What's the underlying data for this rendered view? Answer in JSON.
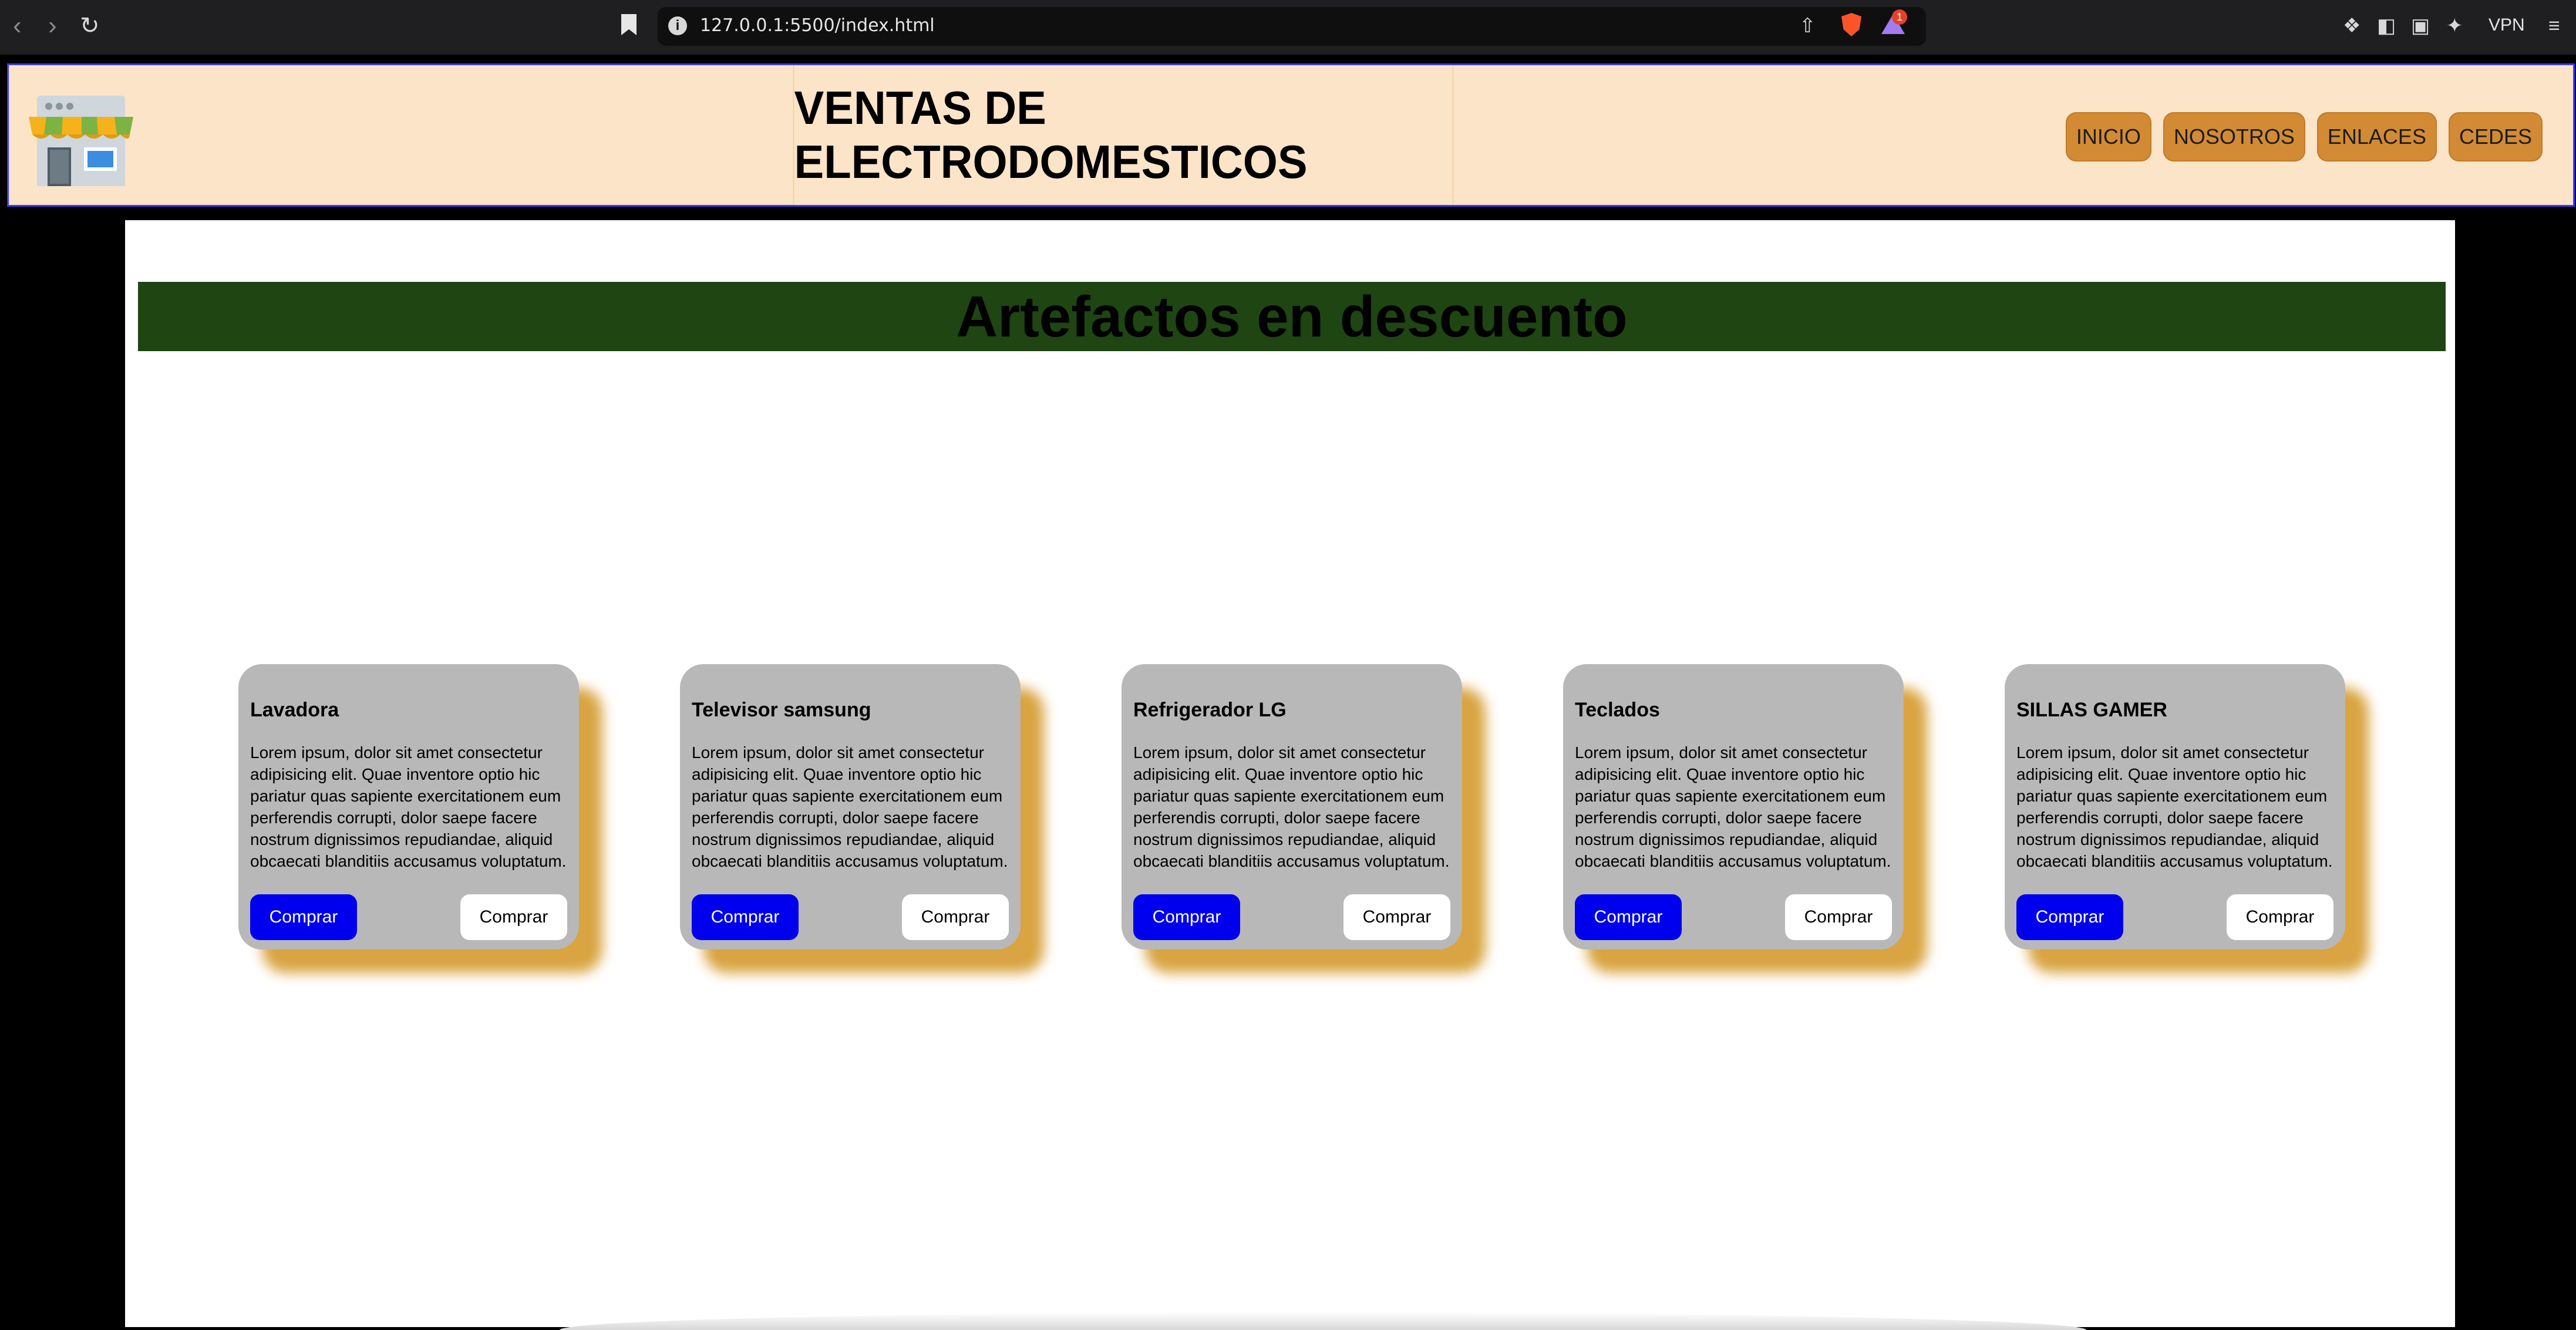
{
  "browser": {
    "url": "127.0.0.1:5500/index.html",
    "vpn_label": "VPN",
    "notification_count": "1"
  },
  "header": {
    "title": "VENTAS DE ELECTRODOMESTICOS",
    "menu": [
      "INICIO",
      "NOSOTROS",
      "ENLACES",
      "CEDES"
    ]
  },
  "banner": {
    "title": "Artefactos en descuento"
  },
  "products": [
    {
      "name": "Lavadora",
      "description": "Lorem ipsum, dolor sit amet consectetur adipisicing elit. Quae inventore optio hic pariatur quas sapiente exercitationem eum perferendis corrupti, dolor saepe facere nostrum dignissimos repudiandae, aliquid obcaecati blanditiis accusamus voluptatum.",
      "buy_label": "Comprar",
      "buy_label_2": "Comprar"
    },
    {
      "name": "Televisor samsung",
      "description": "Lorem ipsum, dolor sit amet consectetur adipisicing elit. Quae inventore optio hic pariatur quas sapiente exercitationem eum perferendis corrupti, dolor saepe facere nostrum dignissimos repudiandae, aliquid obcaecati blanditiis accusamus voluptatum.",
      "buy_label": "Comprar",
      "buy_label_2": "Comprar"
    },
    {
      "name": "Refrigerador LG",
      "description": "Lorem ipsum, dolor sit amet consectetur adipisicing elit. Quae inventore optio hic pariatur quas sapiente exercitationem eum perferendis corrupti, dolor saepe facere nostrum dignissimos repudiandae, aliquid obcaecati blanditiis accusamus voluptatum.",
      "buy_label": "Comprar",
      "buy_label_2": "Comprar"
    },
    {
      "name": "Teclados",
      "description": "Lorem ipsum, dolor sit amet consectetur adipisicing elit. Quae inventore optio hic pariatur quas sapiente exercitationem eum perferendis corrupti, dolor saepe facere nostrum dignissimos repudiandae, aliquid obcaecati blanditiis accusamus voluptatum.",
      "buy_label": "Comprar",
      "buy_label_2": "Comprar"
    },
    {
      "name": "SILLAS GAMER",
      "description": "Lorem ipsum, dolor sit amet consectetur adipisicing elit. Quae inventore optio hic pariatur quas sapiente exercitationem eum perferendis corrupti, dolor saepe facere nostrum dignissimos repudiandae, aliquid obcaecati blanditiis accusamus voluptatum.",
      "buy_label": "Comprar",
      "buy_label_2": "Comprar"
    }
  ],
  "colors": {
    "header_bg": "#fbe4c8",
    "menu_button": "#d28b34",
    "banner_bg": "#1e4512",
    "card_bg": "#b8b8b8",
    "card_shadow": "#d9a441",
    "primary_button": "#0000ee"
  }
}
